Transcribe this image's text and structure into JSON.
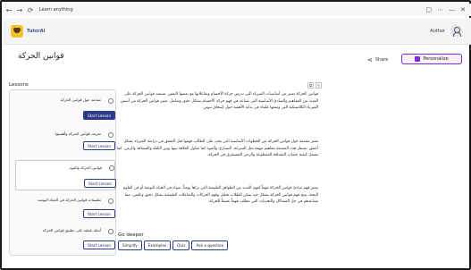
{
  "window": {
    "back": "←",
    "forward": "→",
    "reload": "⟳",
    "title": "Learn anything",
    "icons": [
      "window-icon",
      "more-icon",
      "minimize-icon",
      "close-icon"
    ],
    "right_glyphs": [
      "▢",
      "⋯",
      "—",
      "✕"
    ]
  },
  "app": {
    "brand": "TutorAI",
    "author_label": "Author"
  },
  "page": {
    "title": "قوانين الحركة",
    "share_label": "Share",
    "personalize_label": "Personalize",
    "accent": "#7a2fd8"
  },
  "lessons": {
    "label": "Lessons",
    "items": [
      {
        "title": "مقدمة حول قوانين الحركة",
        "button": "Start Lesson",
        "active": true
      },
      {
        "title": "تعريف قوانين الحركة وأهميتها",
        "button": "Start Lesson",
        "active": false
      },
      {
        "title": "قوانين الحركة والقوة",
        "button": "Start Lesson",
        "active": false
      },
      {
        "title": "تطبيقات قوانين الحركة في الحياة اليومية",
        "button": "Start Lesson",
        "active": false
      },
      {
        "title": "أمثلة عملية على تطبيق قوانين الحركة",
        "button": "Start Lesson",
        "active": false
      }
    ]
  },
  "content": {
    "paragraphs": [
      "قوانين الحركة تعتبر من أساسيات الفيزياء التي تدرس حركة الأجسام وتفاعلاتها مع بعضها البعض. تستمد قوانين الحركة على العديد من المفاهيم والمبادئ الأساسية التي تساعد في فهم حركة الأجسام بشكل دقيق وشامل. تعتبر قوانين الحركة من أسس الفيزياء الكلاسيكية التي وضعها علماء في بداية الأهمية حول إسحاق نيوتن.",
      "تعتبر مقدمة حول قوانين الحركة من الخطوات الأساسية التي يجب على الطالب فهمها قبل التعمق في دراسة الفيزياء بشكل أعمق. تشمل هذه المقدمة مفاهيم مهمة مثل السرعة، التسارع، والقوة كما تتناول العلاقة بينها وبين الكتلة والمسافة والزمن. كما تشمل كيفية حساب المسافة المقطوعة والزمن المستغرق في الحركة.",
      "يعتبر فهم مبادئ قوانين الحركة مهماً لفهم العديد من الظواهر الطبيعية التي نراها يومياً. سواء في الحياة اليومية أو في العلوم البحتة. يتيح فهم قوانين الحركة بشكل جيد يمكن للطلاب تحليل وفهم الحركات والتفاعلات الطبيعية بشكل دقيق وعلمي، مما يساعدهم في حل المشاكل والتحديات التي تتطلب فهماً عميقاً للحركة."
    ]
  },
  "go_deeper": {
    "label": "Go deeper",
    "chips": [
      "Simplify",
      "Examples",
      "Quiz",
      "Ask a question"
    ]
  }
}
